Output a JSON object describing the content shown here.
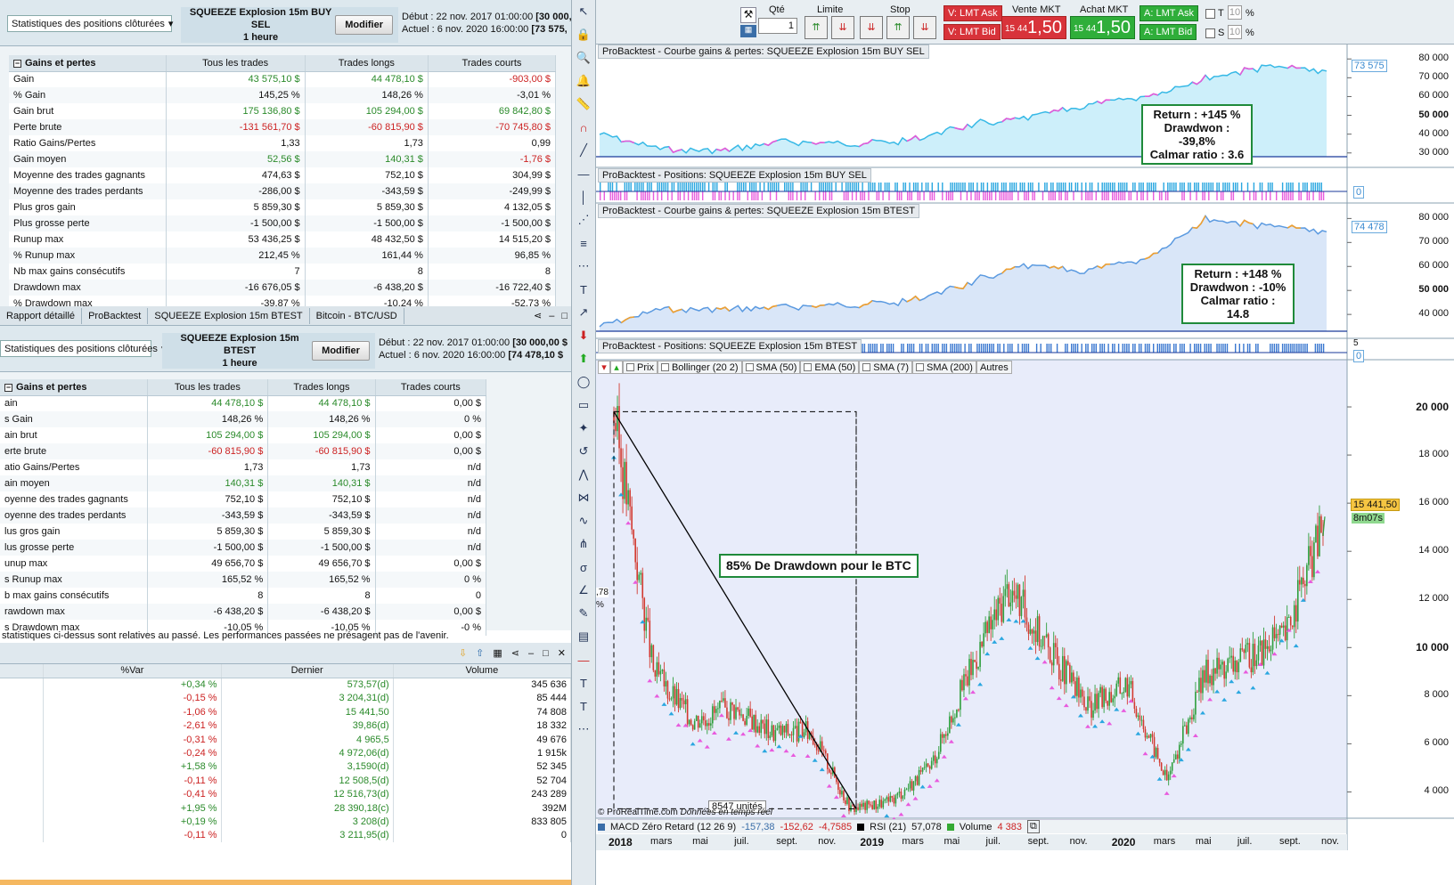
{
  "top": {
    "select": "Statistiques des positions clôturées",
    "title": "SQUEEZE Explosion 15m  BUY SEL",
    "timeframe": "1 heure",
    "modify": "Modifier",
    "debut_label": "Début :",
    "debut": "22 nov. 2017 01:00:00",
    "debut_val": "[30 000,",
    "actuel_label": "Actuel :",
    "actuel": "6 nov. 2020 16:00:00",
    "actuel_val": "[73 575,"
  },
  "stats1": {
    "headers": [
      "Gains et pertes",
      "Tous les trades",
      "Trades longs",
      "Trades courts"
    ],
    "rows": [
      {
        "l": "Gain",
        "a": "43 575,10 $",
        "b": "44 478,10 $",
        "c": "-903,00 $",
        "ca": "pos",
        "cb": "pos",
        "cc": "neg"
      },
      {
        "l": "% Gain",
        "a": "145,25 %",
        "b": "148,26 %",
        "c": "-3,01 %",
        "ca": "",
        "cb": "",
        "cc": ""
      },
      {
        "l": "Gain brut",
        "a": "175 136,80 $",
        "b": "105 294,00 $",
        "c": "69 842,80 $",
        "ca": "pos",
        "cb": "pos",
        "cc": "pos"
      },
      {
        "l": "Perte brute",
        "a": "-131 561,70 $",
        "b": "-60 815,90 $",
        "c": "-70 745,80 $",
        "ca": "neg",
        "cb": "neg",
        "cc": "neg"
      },
      {
        "l": "Ratio Gains/Pertes",
        "a": "1,33",
        "b": "1,73",
        "c": "0,99",
        "ca": "",
        "cb": "",
        "cc": ""
      },
      {
        "l": "Gain moyen",
        "a": "52,56 $",
        "b": "140,31 $",
        "c": "-1,76 $",
        "ca": "pos",
        "cb": "pos",
        "cc": "neg"
      },
      {
        "l": "Moyenne des trades gagnants",
        "a": "474,63 $",
        "b": "752,10 $",
        "c": "304,99 $",
        "ca": "",
        "cb": "",
        "cc": ""
      },
      {
        "l": "Moyenne des trades perdants",
        "a": "-286,00 $",
        "b": "-343,59 $",
        "c": "-249,99 $",
        "ca": "",
        "cb": "",
        "cc": ""
      },
      {
        "l": "Plus gros gain",
        "a": "5 859,30 $",
        "b": "5 859,30 $",
        "c": "4 132,05 $",
        "ca": "",
        "cb": "",
        "cc": ""
      },
      {
        "l": "Plus grosse perte",
        "a": "-1 500,00 $",
        "b": "-1 500,00 $",
        "c": "-1 500,00 $",
        "ca": "",
        "cb": "",
        "cc": ""
      },
      {
        "l": "Runup max",
        "a": "53 436,25 $",
        "b": "48 432,50 $",
        "c": "14 515,20 $",
        "ca": "",
        "cb": "",
        "cc": ""
      },
      {
        "l": "% Runup max",
        "a": "212,45 %",
        "b": "161,44 %",
        "c": "96,85 %",
        "ca": "",
        "cb": "",
        "cc": ""
      },
      {
        "l": "Nb max gains consécutifs",
        "a": "7",
        "b": "8",
        "c": "8",
        "ca": "",
        "cb": "",
        "cc": ""
      },
      {
        "l": "Drawdown max",
        "a": "-16 676,05 $",
        "b": "-6 438,20 $",
        "c": "-16 722,40 $",
        "ca": "",
        "cb": "",
        "cc": ""
      },
      {
        "l": "% Drawdown max",
        "a": "-39,87 %",
        "b": "-10,24 %",
        "c": "-52,73 %",
        "ca": "",
        "cb": "",
        "cc": ""
      }
    ]
  },
  "tabs": [
    "Rapport détaillé",
    "ProBacktest",
    "SQUEEZE Explosion 15m  BTEST",
    "Bitcoin - BTC/USD"
  ],
  "mid": {
    "select": "Statistiques des positions clôturées",
    "title": "SQUEEZE Explosion 15m  BTEST",
    "timeframe": "1 heure",
    "modify": "Modifier",
    "debut_label": "Début :",
    "debut": "22 nov. 2017 01:00:00",
    "debut_val": "[30 000,00 $",
    "actuel_label": "Actuel :",
    "actuel": "6 nov. 2020 16:00:00",
    "actuel_val": "[74 478,10 $"
  },
  "stats2": {
    "headers": [
      "Gains et pertes",
      "Tous les trades",
      "Trades longs",
      "Trades courts"
    ],
    "rows": [
      {
        "l": "ain",
        "a": "44 478,10 $",
        "b": "44 478,10 $",
        "c": "0,00 $",
        "ca": "pos",
        "cb": "pos",
        "cc": ""
      },
      {
        "l": "s Gain",
        "a": "148,26 %",
        "b": "148,26 %",
        "c": "0 %",
        "ca": "",
        "cb": "",
        "cc": ""
      },
      {
        "l": "ain brut",
        "a": "105 294,00 $",
        "b": "105 294,00 $",
        "c": "0,00 $",
        "ca": "pos",
        "cb": "pos",
        "cc": ""
      },
      {
        "l": "erte brute",
        "a": "-60 815,90 $",
        "b": "-60 815,90 $",
        "c": "0,00 $",
        "ca": "neg",
        "cb": "neg",
        "cc": ""
      },
      {
        "l": "atio Gains/Pertes",
        "a": "1,73",
        "b": "1,73",
        "c": "n/d",
        "ca": "",
        "cb": "",
        "cc": ""
      },
      {
        "l": "ain moyen",
        "a": "140,31 $",
        "b": "140,31 $",
        "c": "n/d",
        "ca": "pos",
        "cb": "pos",
        "cc": ""
      },
      {
        "l": "oyenne des trades gagnants",
        "a": "752,10 $",
        "b": "752,10 $",
        "c": "n/d",
        "ca": "",
        "cb": "",
        "cc": ""
      },
      {
        "l": "oyenne des trades perdants",
        "a": "-343,59 $",
        "b": "-343,59 $",
        "c": "n/d",
        "ca": "",
        "cb": "",
        "cc": ""
      },
      {
        "l": "lus gros gain",
        "a": "5 859,30 $",
        "b": "5 859,30 $",
        "c": "n/d",
        "ca": "",
        "cb": "",
        "cc": ""
      },
      {
        "l": "lus grosse perte",
        "a": "-1 500,00 $",
        "b": "-1 500,00 $",
        "c": "n/d",
        "ca": "",
        "cb": "",
        "cc": ""
      },
      {
        "l": "unup max",
        "a": "49 656,70 $",
        "b": "49 656,70 $",
        "c": "0,00 $",
        "ca": "",
        "cb": "",
        "cc": ""
      },
      {
        "l": "s Runup max",
        "a": "165,52 %",
        "b": "165,52 %",
        "c": "0 %",
        "ca": "",
        "cb": "",
        "cc": ""
      },
      {
        "l": "b max gains consécutifs",
        "a": "8",
        "b": "8",
        "c": "0",
        "ca": "",
        "cb": "",
        "cc": ""
      },
      {
        "l": "rawdown max",
        "a": "-6 438,20 $",
        "b": "-6 438,20 $",
        "c": "0,00 $",
        "ca": "",
        "cb": "",
        "cc": ""
      },
      {
        "l": "s Drawdown max",
        "a": "-10,05 %",
        "b": "-10,05 %",
        "c": "-0 %",
        "ca": "",
        "cb": "",
        "cc": ""
      }
    ]
  },
  "disclaimer": "statistiques ci-dessus sont relatives au passé. Les performances passées ne présagent pas de l'avenir.",
  "watchlist": {
    "headers": [
      "%Var",
      "Dernier",
      "Volume"
    ],
    "rows": [
      {
        "v": "+0,34 %",
        "d": "573,57(d)",
        "vol": "345 636",
        "c": "pos"
      },
      {
        "v": "-0,15 %",
        "d": "3 204,31(d)",
        "vol": "85 444",
        "c": "neg"
      },
      {
        "v": "-1,06 %",
        "d": "15 441,50",
        "vol": "74 808",
        "c": "neg"
      },
      {
        "v": "-2,61 %",
        "d": "39,86(d)",
        "vol": "18 332",
        "c": "neg"
      },
      {
        "v": "-0,31 %",
        "d": "4 965,5",
        "vol": "49 676",
        "c": "neg"
      },
      {
        "v": "-0,24 %",
        "d": "4 972,06(d)",
        "vol": "1 915k",
        "c": "neg"
      },
      {
        "v": "+1,58 %",
        "d": "3,1590(d)",
        "vol": "52 345",
        "c": "pos"
      },
      {
        "v": "-0,11 %",
        "d": "12 508,5(d)",
        "vol": "52 704",
        "c": "neg"
      },
      {
        "v": "-0,41 %",
        "d": "12 516,73(d)",
        "vol": "243 289",
        "c": "neg"
      },
      {
        "v": "+1,95 %",
        "d": "28 390,18(c)",
        "vol": "392M",
        "c": "pos"
      },
      {
        "v": "+0,19 %",
        "d": "3 208(d)",
        "vol": "833 805",
        "c": "pos"
      },
      {
        "v": "-0,11 %",
        "d": "3 211,95(d)",
        "vol": "0",
        "c": "neg"
      }
    ]
  },
  "order": {
    "qty_label": "Qté",
    "qty": "1",
    "limit_label": "Limite",
    "stop_label": "Stop",
    "v_ask": "V: LMT Ask",
    "v_bid": "V: LMT Bid",
    "vente_label": "Vente MKT",
    "vente_time": "15 44",
    "vente_price": "1,50",
    "achat_label": "Achat MKT",
    "achat_time": "15 44",
    "achat_price": "1,50",
    "a_ask": "A: LMT Ask",
    "a_bid": "A: LMT Bid",
    "t_label": "T",
    "t_val": "10",
    "s_label": "S",
    "s_val": "10",
    "pct": "%"
  },
  "panes": {
    "eq1_title": "ProBacktest - Courbe gains & pertes: SQUEEZE Explosion 15m  BUY SEL",
    "pos1_title": "ProBacktest - Positions: SQUEEZE Explosion 15m  BUY SEL",
    "eq2_title": "ProBacktest - Courbe gains & pertes: SQUEEZE Explosion 15m  BTEST",
    "pos2_title": "ProBacktest - Positions: SQUEEZE Explosion 15m  BTEST",
    "eq1_last": "73 575",
    "eq2_last": "74 478",
    "pos1_zero": "0",
    "pos2_five": "5",
    "pos2_zero": "0",
    "eq1_ticks": [
      "80 000",
      "70 000",
      "60 000",
      "50 000",
      "40 000",
      "30 000"
    ],
    "eq2_ticks": [
      "80 000",
      "70 000",
      "60 000",
      "50 000",
      "40 000"
    ]
  },
  "annot": {
    "a1": [
      "Return : +145 %",
      "Drawdwon : -39,8%",
      "Calmar ratio  : 3.6"
    ],
    "a2": [
      "Return : +148 %",
      "Drawdwon : -10%",
      "Calmar ratio  : 14.8"
    ],
    "a3": "85% De Drawdown pour le BTC",
    "units": "8547 unités"
  },
  "indicators": [
    "Prix",
    "Bollinger (20 2)",
    "SMA (50)",
    "EMA (50)",
    "SMA (7)",
    "SMA (200)",
    "Autres"
  ],
  "price": {
    "ticks": [
      "20 000",
      "18 000",
      "16 000",
      "14 000",
      "12 000",
      "10 000",
      "8 000",
      "6 000",
      "4 000"
    ],
    "last": "15 441,50",
    "timer": "8m07s",
    "left_edge": ",78",
    "left_pct": "%"
  },
  "bottom": {
    "macd": "MACD Zéro Retard (12 26 9)",
    "macd_v1": "-157,38",
    "macd_v2": "-152,62",
    "macd_v3": "-4,7585",
    "rsi": "RSI (21)",
    "rsi_v": "57,078",
    "vol": "Volume",
    "vol_v": "4 383",
    "copyright": "© ProRealTime.com",
    "realtime": "Données en temps réel"
  },
  "xaxis": [
    "2018",
    "mars",
    "mai",
    "juil.",
    "sept.",
    "nov.",
    "2019",
    "mars",
    "mai",
    "juil.",
    "sept.",
    "nov.",
    "2020",
    "mars",
    "mai",
    "juil.",
    "sept.",
    "nov."
  ],
  "chart_data": [
    {
      "type": "line",
      "title": "ProBacktest - Courbe gains & pertes: SQUEEZE Explosion 15m  BUY SEL",
      "x": [
        "2018-01",
        "2018-04",
        "2018-07",
        "2018-10",
        "2019-01",
        "2019-04",
        "2019-07",
        "2019-10",
        "2020-01",
        "2020-04",
        "2020-07",
        "2020-10",
        "2020-11"
      ],
      "values": [
        40000,
        32000,
        31000,
        36000,
        35000,
        36000,
        44000,
        48000,
        55000,
        60000,
        70000,
        76000,
        73575
      ],
      "ylim": [
        28000,
        82000
      ]
    },
    {
      "type": "line",
      "title": "ProBacktest - Courbe gains & pertes: SQUEEZE Explosion 15m  BTEST",
      "x": [
        "2018-01",
        "2018-04",
        "2018-07",
        "2018-10",
        "2019-01",
        "2019-04",
        "2019-07",
        "2019-10",
        "2020-01",
        "2020-04",
        "2020-07",
        "2020-10",
        "2020-11"
      ],
      "values": [
        35000,
        42000,
        42000,
        43000,
        44000,
        45000,
        52000,
        60000,
        58000,
        63000,
        80000,
        77000,
        74478
      ],
      "ylim": [
        33000,
        82000
      ]
    },
    {
      "type": "line",
      "title": "Bitcoin - BTC/USD",
      "x": [
        "2017-12",
        "2018-02",
        "2018-04",
        "2018-06",
        "2018-08",
        "2018-10",
        "2018-12",
        "2019-02",
        "2019-04",
        "2019-06",
        "2019-07",
        "2019-09",
        "2019-11",
        "2020-01",
        "2020-03",
        "2020-05",
        "2020-07",
        "2020-09",
        "2020-11"
      ],
      "values": [
        19800,
        9000,
        7000,
        7500,
        6500,
        6500,
        3300,
        3600,
        5000,
        9000,
        12500,
        10000,
        7500,
        8500,
        4500,
        9000,
        9500,
        10500,
        15441.5
      ],
      "ylim": [
        2500,
        21000
      ]
    }
  ]
}
